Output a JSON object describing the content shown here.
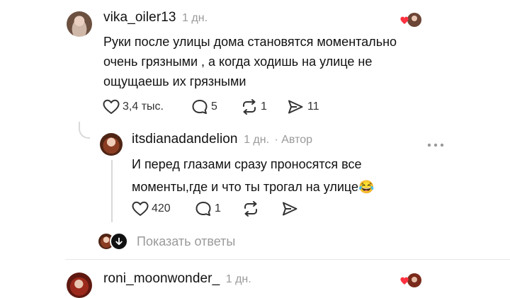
{
  "comments": [
    {
      "username": "vika_oiler13",
      "time": "1 дн.",
      "text_lines": [
        "Руки после улицы дома становятся моментально",
        "очень грязными , а когда ходишь на улице не",
        "ощущаешь их грязными"
      ],
      "likes": "3,4 тыс.",
      "replies": "5",
      "reposts": "1",
      "shares": "11"
    },
    {
      "username": "itsdianadandelion",
      "time": "1 дн.",
      "author_label": "· Автор",
      "text_lines": [
        "И перед глазами сразу проносятся все",
        "моменты,где и что ты трогал на улице😂"
      ],
      "likes": "420",
      "replies": "1"
    },
    {
      "username": "roni_moonwonder_",
      "time": "1 дн."
    }
  ],
  "show_replies_label": "Показать ответы",
  "icons": {
    "like": "heart-icon",
    "reply": "comment-bubble-icon",
    "repost": "repost-icon",
    "share": "send-icon",
    "more": "more-dots-icon"
  },
  "colors": {
    "heart_red": "#ff3040",
    "meta_gray": "#9a9a9a"
  }
}
